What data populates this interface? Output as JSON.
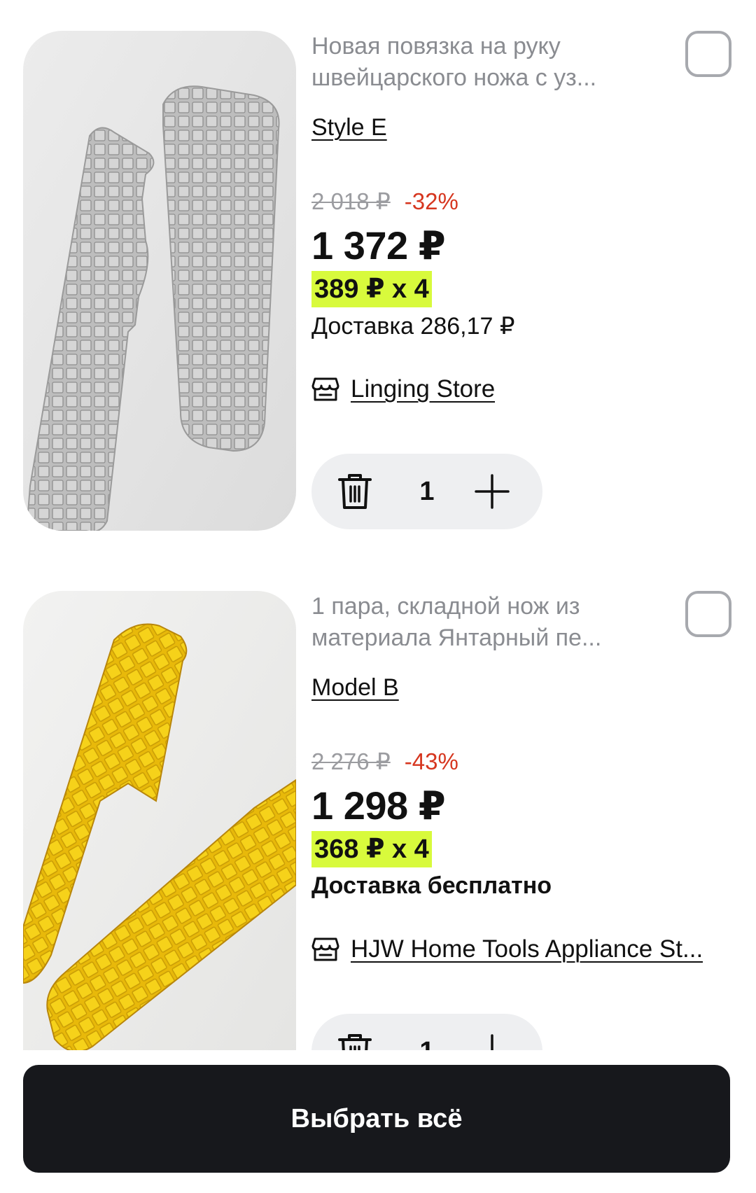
{
  "items": [
    {
      "title": "Новая повязка на руку швейцарского ножа с уз...",
      "variant": "Style E",
      "old_price": "2 018 ₽",
      "discount": "-32%",
      "price": "1 372 ₽",
      "installment": "389 ₽ x 4",
      "delivery": "Доставка 286,17 ₽",
      "store": "Linging Store",
      "quantity": "1",
      "image": "silver-knife-scales-photo"
    },
    {
      "title": "1 пара, складной нож из материала Янтарный пе...",
      "variant": "Model B",
      "old_price": "2 276 ₽",
      "discount": "-43%",
      "price": "1 298 ₽",
      "installment": "368 ₽ x 4",
      "delivery": "Доставка бесплатно",
      "store": "HJW Home Tools Appliance St...",
      "quantity": "1",
      "image": "amber-knife-scales-photo"
    }
  ],
  "bottom": {
    "select_all_label": "Выбрать всё"
  },
  "colors": {
    "installment_highlight": "#d8fa3c",
    "discount": "#d6361f",
    "button_bg": "#17181c",
    "stepper_bg": "#eeeff1"
  },
  "icons": [
    "checkbox-icon",
    "store-icon",
    "trash-icon",
    "plus-icon"
  ]
}
